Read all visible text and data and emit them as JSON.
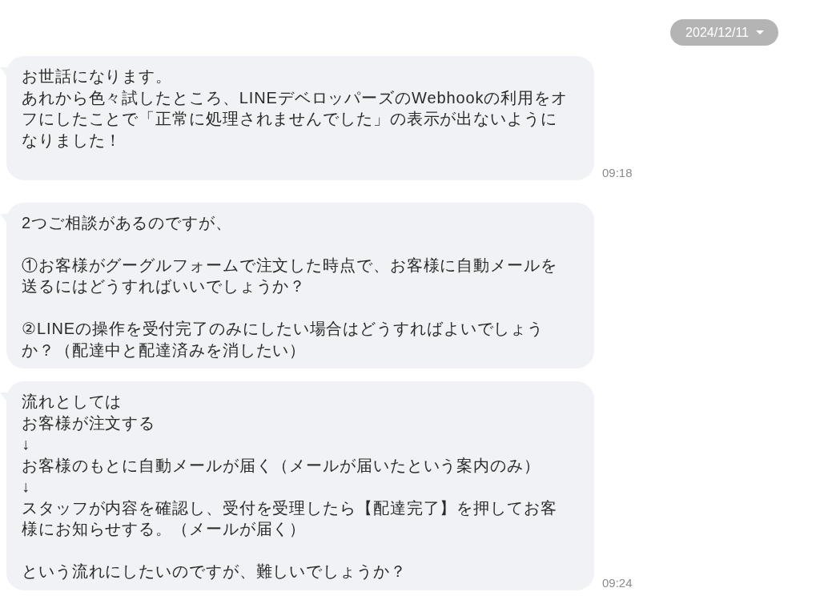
{
  "date_selector": {
    "label": "2024/12/11"
  },
  "messages": [
    {
      "blocks": [
        {
          "lines": [
            "お世話になります。",
            "あれから色々試したところ、LINEデベロッパーズのWebhookの利用をオフにしたことで「正常に処理されませんでした」の表示が出ないようになりました！"
          ]
        }
      ],
      "trailing_blank_line": true,
      "time": "09:18"
    },
    {
      "blocks": [
        {
          "lines": [
            "2つご相談があるのですが、"
          ]
        },
        {
          "lines": [
            "①お客様がグーグルフォームで注文した時点で、お客様に自動メールを送るにはどうすればいいでしょうか？"
          ]
        },
        {
          "lines": [
            "②LINEの操作を受付完了のみにしたい場合はどうすればよいでしょうか？（配達中と配達済みを消したい）"
          ]
        }
      ]
    },
    {
      "blocks": [
        {
          "lines": [
            "流れとしては",
            "お客様が注文する",
            "↓",
            "お客様のもとに自動メールが届く（メールが届いたという案内のみ）",
            "↓",
            "スタッフが内容を確認し、受付を受理したら【配達完了】を押してお客様にお知らせする。（メールが届く）"
          ]
        },
        {
          "lines": [
            "という流れにしたいのですが、難しいでしょうか？"
          ]
        }
      ],
      "time": "09:24"
    }
  ]
}
